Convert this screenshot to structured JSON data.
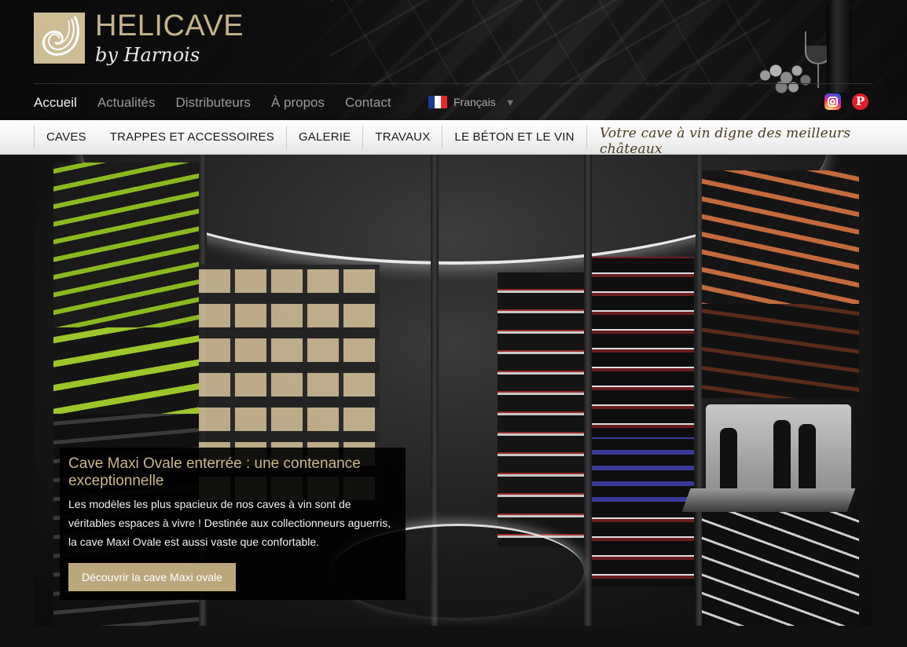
{
  "brand": {
    "name": "HELICAVE",
    "subtitle": "by Harnois",
    "accent_color": "#c5b48a"
  },
  "top_nav": {
    "items": [
      {
        "label": "Accueil",
        "active": true
      },
      {
        "label": "Actualités",
        "active": false
      },
      {
        "label": "Distributeurs",
        "active": false
      },
      {
        "label": "À propos",
        "active": false
      },
      {
        "label": "Contact",
        "active": false
      }
    ]
  },
  "language": {
    "label": "Français",
    "caret": "▼",
    "flag_colors": [
      "#1f3a93",
      "#ffffff",
      "#e52a2a"
    ]
  },
  "social": {
    "instagram_icon": "instagram-icon",
    "pinterest_icon": "pinterest-icon",
    "pinterest_glyph": "P"
  },
  "main_nav": {
    "items": [
      {
        "label": "CAVES"
      },
      {
        "label": "TRAPPES ET ACCESSOIRES"
      },
      {
        "label": "GALERIE"
      },
      {
        "label": "TRAVAUX"
      },
      {
        "label": "LE BÉTON ET LE VIN"
      }
    ],
    "tagline": "Votre cave à vin digne des meilleurs châteaux"
  },
  "hero": {
    "caption_title": "Cave Maxi Ovale enterrée : une contenance exceptionnelle",
    "caption_text": "Les modèles les plus spacieux de nos caves à vin sont de véritables espaces à vivre ! Destinée aux collectionneurs aguerris, la cave Maxi Ovale est aussi vaste que confortable.",
    "cta_label": "Découvrir la cave Maxi ovale",
    "cta_color": "#bba77c"
  }
}
